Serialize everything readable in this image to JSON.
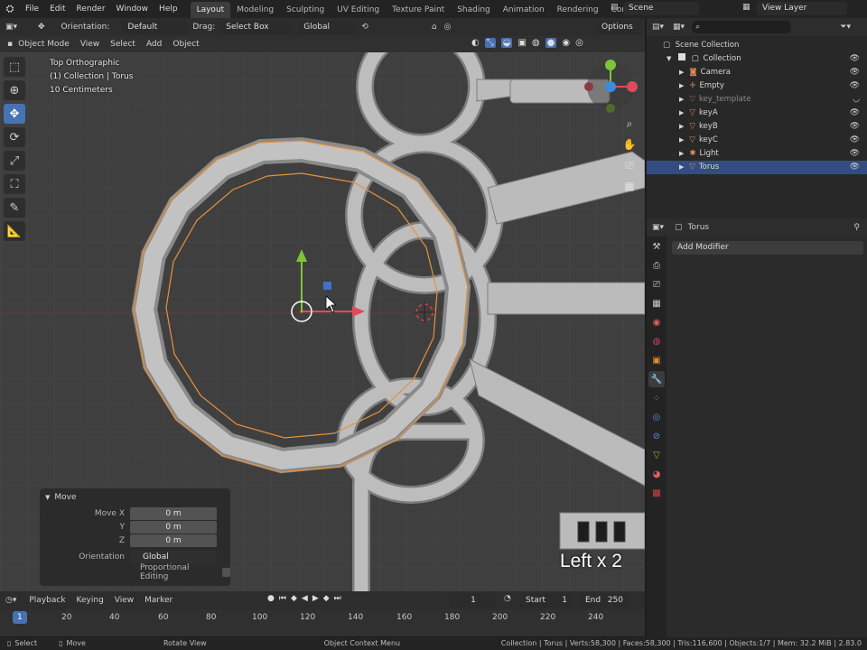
{
  "topbar": {
    "menu": [
      "File",
      "Edit",
      "Render",
      "Window",
      "Help"
    ],
    "workspaces": [
      "Layout",
      "Modeling",
      "Sculpting",
      "UV Editing",
      "Texture Paint",
      "Shading",
      "Animation",
      "Rendering",
      "Compositing"
    ],
    "active_workspace": "Layout",
    "scene": "Scene",
    "view_layer": "View Layer"
  },
  "viewport_header": {
    "orientation_label": "Orientation:",
    "orientation_value": "Default",
    "drag_label": "Drag:",
    "drag_value": "Select Box",
    "transform_orientation": "Global",
    "options": "Options"
  },
  "viewport_header2": {
    "mode": "Object Mode",
    "view": "View",
    "select": "Select",
    "add": "Add",
    "object": "Object"
  },
  "viewport": {
    "view_name": "Top Orthographic",
    "collection_info": "(1) Collection | Torus",
    "scale": "10 Centimeters",
    "keypress_overlay": "Left x 2"
  },
  "move_panel": {
    "title": "Move",
    "rows": [
      {
        "label": "Move X",
        "value": "0 m"
      },
      {
        "label": "Y",
        "value": "0 m"
      },
      {
        "label": "Z",
        "value": "0 m"
      }
    ],
    "orientation_label": "Orientation",
    "orientation_value": "Global",
    "proportional_label": "Proportional Editing"
  },
  "timeline": {
    "playback": "Playback",
    "keying": "Keying",
    "view": "View",
    "marker": "Marker",
    "current_frame": "1",
    "start_label": "Start",
    "start": "1",
    "end_label": "End",
    "end": "250",
    "ticks": [
      "1",
      "20",
      "40",
      "60",
      "80",
      "100",
      "120",
      "140",
      "160",
      "180",
      "200",
      "220",
      "240"
    ]
  },
  "statusbar": {
    "left": [
      "Select",
      "Move",
      "Rotate View",
      "Object Context Menu"
    ],
    "right": "Collection | Torus | Verts:58,300 | Faces:58,300 | Tris:116,600 | Objects:1/7 | Mem: 32.2 MiB | 2.83.0"
  },
  "outliner": {
    "root": "Scene Collection",
    "collection": "Collection",
    "items": [
      {
        "name": "Camera",
        "icon": "camera-icon",
        "color": "#e48a57",
        "dim": false,
        "selected": false
      },
      {
        "name": "Empty",
        "icon": "empty-icon",
        "color": "#e48a57",
        "dim": false,
        "selected": false
      },
      {
        "name": "key_template",
        "icon": "mesh-icon",
        "color": "#8f6a56",
        "dim": true,
        "selected": false
      },
      {
        "name": "keyA",
        "icon": "mesh-icon",
        "color": "#e48a57",
        "dim": false,
        "selected": false
      },
      {
        "name": "keyB",
        "icon": "mesh-icon",
        "color": "#e48a57",
        "dim": false,
        "selected": false
      },
      {
        "name": "keyC",
        "icon": "mesh-icon",
        "color": "#e48a57",
        "dim": false,
        "selected": false
      },
      {
        "name": "Light",
        "icon": "light-icon",
        "color": "#e48a57",
        "dim": false,
        "selected": false
      },
      {
        "name": "Torus",
        "icon": "mesh-icon",
        "color": "#e48a57",
        "dim": false,
        "selected": true
      }
    ]
  },
  "properties": {
    "object_name": "Torus",
    "add_modifier": "Add Modifier"
  },
  "colors": {
    "accent": "#4772b3",
    "selection_outline": "#e8913a",
    "x_axis": "#e04a5a",
    "y_axis": "#7ec33a",
    "z_axis": "#3d8be0",
    "mesh": "#b9b9b9"
  }
}
